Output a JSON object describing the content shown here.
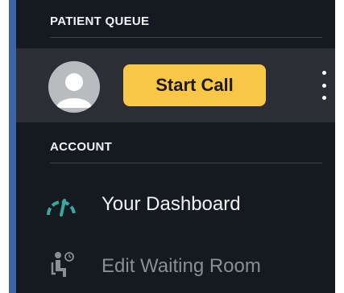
{
  "patient_queue": {
    "header": "PATIENT QUEUE",
    "start_call_label": "Start Call"
  },
  "account": {
    "header": "ACCOUNT",
    "items": [
      {
        "label": "Your Dashboard",
        "icon": "gauge-icon",
        "color": "#f2f3f5",
        "icon_color": "#3aa8a0"
      },
      {
        "label": "Edit Waiting Room",
        "icon": "waiting-room-icon",
        "color": "#8a8f96",
        "icon_color": "#8a8f96"
      }
    ]
  },
  "colors": {
    "accent_bar": "#3d63a8",
    "panel_bg": "#151a20",
    "highlight_row_bg": "#2b2f35",
    "start_call_bg": "#f8c748"
  }
}
